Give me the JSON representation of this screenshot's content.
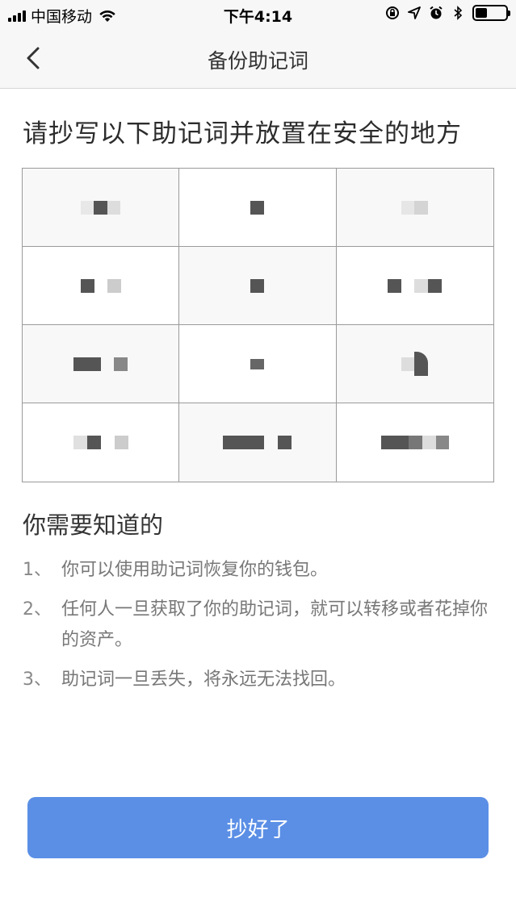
{
  "status_bar": {
    "carrier": "中国移动",
    "time": "下午4:14"
  },
  "nav": {
    "title": "备份助记词"
  },
  "heading": "请抄写以下助记词并放置在安全的地方",
  "info_title": "你需要知道的",
  "tips": [
    {
      "num": "1、",
      "text": "你可以使用助记词恢复你的钱包。"
    },
    {
      "num": "2、",
      "text": "任何人一旦获取了你的助记词，就可以转移或者花掉你的资产。"
    },
    {
      "num": "3、",
      "text": "助记词一旦丢失，将永远无法找回。"
    }
  ],
  "confirm_button": "抄好了",
  "colors": {
    "accent": "#5b8fe6",
    "grid_line": "#9a9a9a",
    "mosaic": "#5a5a5a"
  }
}
